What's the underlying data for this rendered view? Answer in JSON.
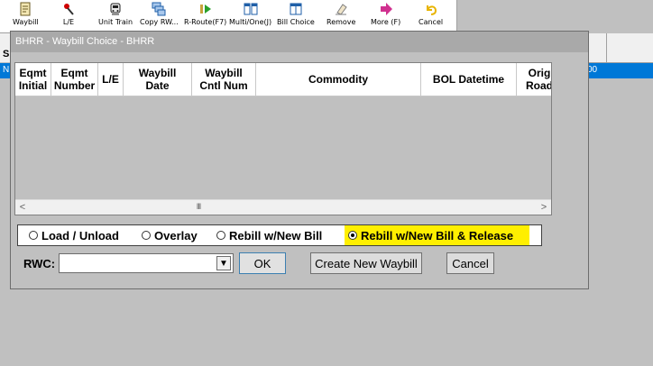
{
  "toolbar": {
    "items": [
      {
        "label": "Waybill",
        "icon": "waybill-icon"
      },
      {
        "label": "L/E",
        "icon": "pin-icon"
      },
      {
        "label": "Unit Train",
        "icon": "train-icon"
      },
      {
        "label": "Copy RW...",
        "icon": "copy-icon"
      },
      {
        "label": "R-Route(F7)",
        "icon": "route-icon"
      },
      {
        "label": "Multi/One(J)",
        "icon": "multi-icon"
      },
      {
        "label": "Bill Choice",
        "icon": "bill-choice-icon"
      },
      {
        "label": "Remove",
        "icon": "eraser-icon"
      },
      {
        "label": "More (F)",
        "icon": "arrow-right-icon"
      },
      {
        "label": "Cancel",
        "icon": "undo-icon"
      }
    ]
  },
  "background": {
    "s_label": "S",
    "row_left": "N",
    "row_right": "00"
  },
  "dialog": {
    "title": "BHRR - Waybill Choice - BHRR",
    "grid": {
      "columns": [
        "Eqmt\nInitial",
        "Eqmt\nNumber",
        "L/E",
        "Waybill\nDate",
        "Waybill\nCntl Num",
        "Commodity",
        "BOL Datetime",
        "Orig\nRoad"
      ],
      "rows": [],
      "scroll_thumb": "III"
    },
    "radios": [
      {
        "label": "Load / Unload",
        "selected": false
      },
      {
        "label": "Overlay",
        "selected": false
      },
      {
        "label": "Rebill w/New Bill",
        "selected": false
      },
      {
        "label": "Rebill w/New Bill & Release",
        "selected": true
      }
    ],
    "rwc": {
      "label": "RWC:",
      "value": ""
    },
    "buttons": {
      "ok": "OK",
      "create": "Create New Waybill",
      "cancel": "Cancel"
    }
  },
  "colors": {
    "highlight": "#ffef00",
    "selection": "#0078d7",
    "title_bar": "#a9a9a9"
  }
}
